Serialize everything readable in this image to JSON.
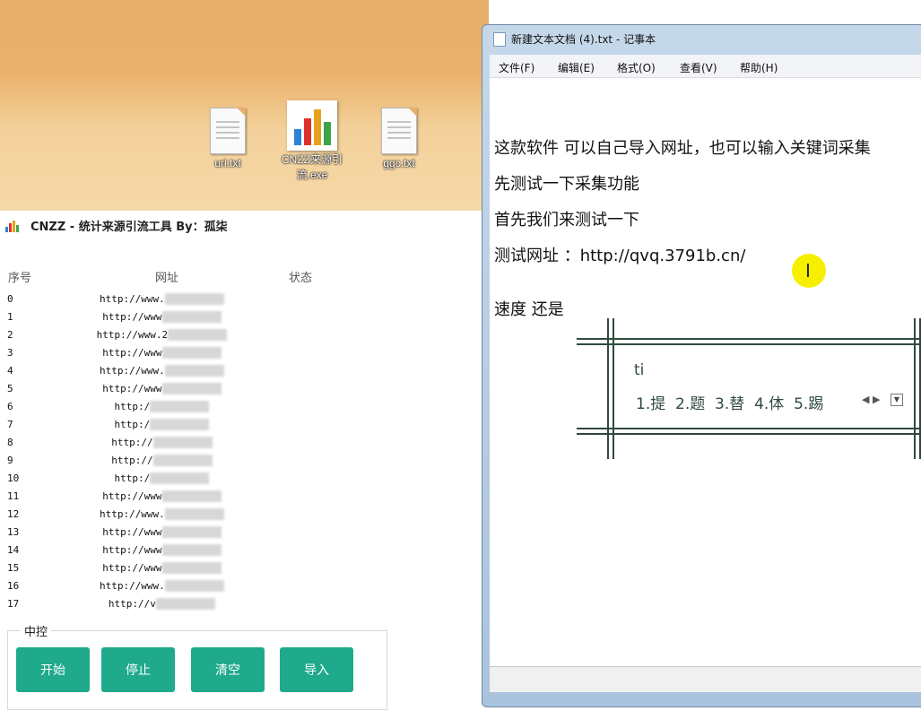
{
  "desktop": {
    "icons": [
      {
        "label": "url.txt",
        "kind": "text-file-icon"
      },
      {
        "label": "CNZZ来源引流.exe",
        "kind": "chart-app-icon"
      },
      {
        "label": "ggc.txt",
        "kind": "text-file-icon"
      }
    ]
  },
  "tool": {
    "title": "CNZZ - 统计来源引流工具 By：孤柒",
    "columns": {
      "index": "序号",
      "url": "网址",
      "status": "状态"
    },
    "rows": [
      {
        "index": "0",
        "url": "http://www.",
        "status": ""
      },
      {
        "index": "1",
        "url": "http://www",
        "status": ""
      },
      {
        "index": "2",
        "url": "http://www.2",
        "status": ""
      },
      {
        "index": "3",
        "url": "http://www",
        "status": ""
      },
      {
        "index": "4",
        "url": "http://www.",
        "status": ""
      },
      {
        "index": "5",
        "url": "http://www",
        "status": ""
      },
      {
        "index": "6",
        "url": "http:/",
        "status": ""
      },
      {
        "index": "7",
        "url": "http:/",
        "status": ""
      },
      {
        "index": "8",
        "url": "http://",
        "status": ""
      },
      {
        "index": "9",
        "url": "http://",
        "status": ""
      },
      {
        "index": "10",
        "url": "http:/",
        "status": ""
      },
      {
        "index": "11",
        "url": "http://www",
        "status": ""
      },
      {
        "index": "12",
        "url": "http://www.",
        "status": ""
      },
      {
        "index": "13",
        "url": "http://www",
        "status": ""
      },
      {
        "index": "14",
        "url": "http://www",
        "status": ""
      },
      {
        "index": "15",
        "url": "http://www",
        "status": ""
      },
      {
        "index": "16",
        "url": "http://www.",
        "status": ""
      },
      {
        "index": "17",
        "url": "http://v",
        "status": ""
      }
    ],
    "control_group": {
      "label": "中控",
      "buttons": {
        "start": "开始",
        "stop": "停止",
        "clear": "清空",
        "import": "导入"
      }
    },
    "colors": {
      "button": "#1faa8c"
    }
  },
  "notepad": {
    "title": "新建文本文档 (4).txt - 记事本",
    "menu": [
      "文件(F)",
      "编辑(E)",
      "格式(O)",
      "查看(V)",
      "帮助(H)"
    ],
    "lines": [
      "这款软件 可以自己导入网址，也可以输入关键词采集",
      "先测试一下采集功能",
      "首先我们来测试一下",
      "测试网址 ：http://qvq.3791b.cn/",
      "",
      "速度 还是"
    ]
  },
  "ime": {
    "composition": "ti",
    "candidates": "1.提  2.题  3.替  4.体  5.踢"
  }
}
